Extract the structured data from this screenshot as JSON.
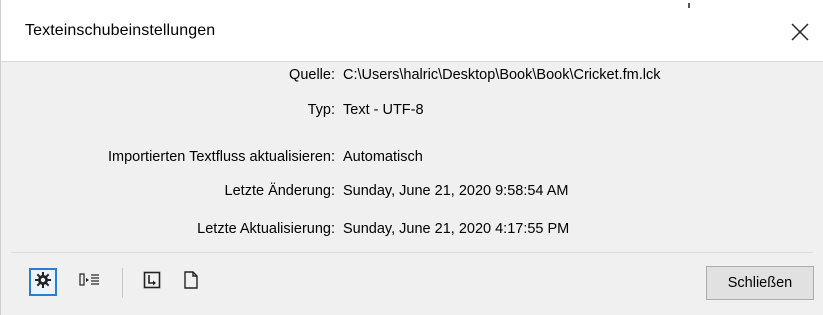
{
  "dialog": {
    "title": "Texteinschubeinstellungen",
    "close_icon": "close-icon"
  },
  "info": {
    "rows": [
      {
        "label": "Quelle:",
        "value": "C:\\Users\\halric\\Desktop\\Book\\Book\\Cricket.fm.lck"
      },
      {
        "label": "Typ:",
        "value": "Text - UTF-8"
      },
      {
        "label": "Importierten Textfluss aktualisieren:",
        "value": "Automatisch"
      },
      {
        "label": "Letzte Änderung:",
        "value": "Sunday, June 21, 2020 9:58:54 AM"
      },
      {
        "label": "Letzte Aktualisierung:",
        "value": "Sunday, June 21, 2020 4:17:55 PM"
      }
    ]
  },
  "toolbar": {
    "icons": [
      "settings-gear-icon",
      "import-text-icon",
      "update-icon",
      "document-icon"
    ],
    "close_label": "Schließen"
  },
  "colors": {
    "accent": "#2b7cd3",
    "background": "#f0f0f0",
    "titlebar": "#ffffff"
  }
}
